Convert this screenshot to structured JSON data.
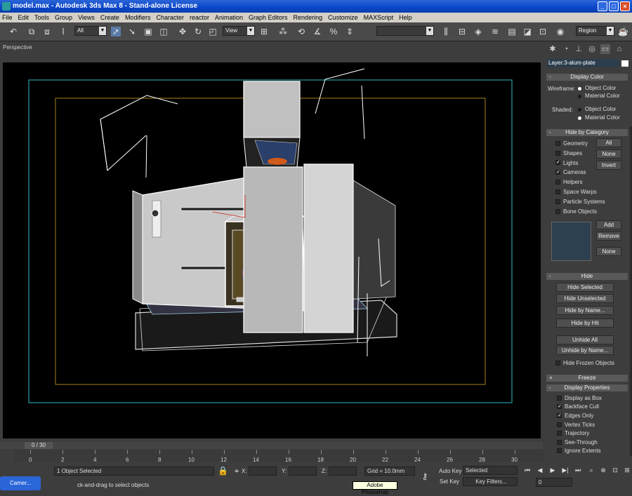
{
  "window": {
    "title": "model.max - Autodesk 3ds Max 8 - Stand-alone License"
  },
  "menu": [
    "File",
    "Edit",
    "Tools",
    "Group",
    "Views",
    "Create",
    "Modifiers",
    "Character",
    "reactor",
    "Animation",
    "Graph Editors",
    "Rendering",
    "Customize",
    "MAXScript",
    "Help"
  ],
  "toolbar": {
    "selection_filter": "All",
    "ref_coord": "View",
    "named_selection": "",
    "render_type": "Region"
  },
  "viewport": {
    "label": "Perspective"
  },
  "command_panel": {
    "layer": "Layer:3-alum-plate",
    "display_color": {
      "title": "Display Color",
      "wireframe_label": "Wireframe:",
      "shaded_label": "Shaded:",
      "object_color": "Object Color",
      "material_color": "Material Color"
    },
    "hide_by_category": {
      "title": "Hide by Category",
      "items": [
        {
          "label": "Geometry",
          "checked": false
        },
        {
          "label": "Shapes",
          "checked": false
        },
        {
          "label": "Lights",
          "checked": true
        },
        {
          "label": "Cameras",
          "checked": true
        },
        {
          "label": "Helpers",
          "checked": false
        },
        {
          "label": "Space Warps",
          "checked": false
        },
        {
          "label": "Particle Systems",
          "checked": false
        },
        {
          "label": "Bone Objects",
          "checked": false
        }
      ],
      "all": "All",
      "none": "None",
      "invert": "Invert",
      "add": "Add",
      "remove": "Remove",
      "none2": "None"
    },
    "hide": {
      "title": "Hide",
      "hide_selected": "Hide Selected",
      "hide_unselected": "Hide Unselected",
      "hide_by_name": "Hide by Name...",
      "hide_by_hit": "Hide by Hit",
      "unhide_all": "Unhide All",
      "unhide_by_name": "Unhide by Name...",
      "hide_frozen": "Hide Frozen Objects"
    },
    "freeze": {
      "title": "Freeze"
    },
    "display_properties": {
      "title": "Display Properties",
      "items": [
        {
          "label": "Display as Box",
          "checked": false
        },
        {
          "label": "Backface Cull",
          "checked": true
        },
        {
          "label": "Edges Only",
          "checked": true
        },
        {
          "label": "Vertex Ticks",
          "checked": false
        },
        {
          "label": "Trajectory",
          "checked": false
        },
        {
          "label": "See-Through",
          "checked": false
        },
        {
          "label": "Ignore Extents",
          "checked": false
        }
      ]
    }
  },
  "timeline": {
    "slider_label": "0 / 30",
    "ticks": [
      "0",
      "2",
      "4",
      "6",
      "8",
      "10",
      "12",
      "14",
      "16",
      "18",
      "20",
      "22",
      "24",
      "26",
      "28",
      "30"
    ]
  },
  "status": {
    "selected": "1 Object Selected",
    "prompt": "ck-and-drag to select objects",
    "x_label": "X:",
    "y_label": "Y:",
    "z_label": "Z:",
    "grid": "Grid = 10.0mm",
    "auto_key": "Auto Key",
    "set_key": "Set Key",
    "key_mode": "Selected",
    "key_filters": "Key Filters...",
    "frame": "0"
  },
  "taskbar": {
    "button": "Camer...",
    "tooltip": "Adobe Photoshop"
  }
}
